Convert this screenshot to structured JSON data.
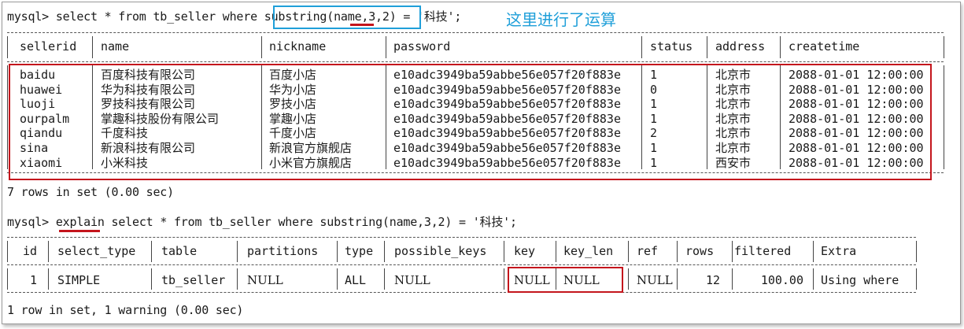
{
  "query1": {
    "prompt": "mysql>",
    "text_before": " select * from tb_seller where ",
    "highlight": "substring(name,3,2)",
    "text_after": " = '科技';",
    "annotation": "这里进行了运算"
  },
  "table1": {
    "columns": [
      "sellerid",
      "name",
      "nickname",
      "password",
      "status",
      "address",
      "createtime"
    ],
    "rows": [
      [
        "baidu",
        "百度科技有限公司",
        "百度小店",
        "e10adc3949ba59abbe56e057f20f883e",
        "1",
        "北京市",
        "2088-01-01 12:00:00"
      ],
      [
        "huawei",
        "华为科技有限公司",
        "华为小店",
        "e10adc3949ba59abbe56e057f20f883e",
        "0",
        "北京市",
        "2088-01-01 12:00:00"
      ],
      [
        "luoji",
        "罗技科技有限公司",
        "罗技小店",
        "e10adc3949ba59abbe56e057f20f883e",
        "1",
        "北京市",
        "2088-01-01 12:00:00"
      ],
      [
        "ourpalm",
        "掌趣科技股份有限公司",
        "掌趣小店",
        "e10adc3949ba59abbe56e057f20f883e",
        "1",
        "北京市",
        "2088-01-01 12:00:00"
      ],
      [
        "qiandu",
        "千度科技",
        "千度小店",
        "e10adc3949ba59abbe56e057f20f883e",
        "2",
        "北京市",
        "2088-01-01 12:00:00"
      ],
      [
        "sina",
        "新浪科技有限公司",
        "新浪官方旗舰店",
        "e10adc3949ba59abbe56e057f20f883e",
        "1",
        "北京市",
        "2088-01-01 12:00:00"
      ],
      [
        "xiaomi",
        "小米科技",
        "小米官方旗舰店",
        "e10adc3949ba59abbe56e057f20f883e",
        "1",
        "西安市",
        "2088-01-01 12:00:00"
      ]
    ],
    "footer": "7 rows in set (0.00 sec)"
  },
  "query2": {
    "prompt": "mysql>",
    "keyword": "explain",
    "text": " select * from tb_seller where substring(name,3,2) = '科技';"
  },
  "table2": {
    "columns": [
      "id",
      "select_type",
      "table",
      "partitions",
      "type",
      "possible_keys",
      "key",
      "key_len",
      "ref",
      "rows",
      "filtered",
      "Extra"
    ],
    "row": [
      "1",
      "SIMPLE",
      "tb_seller",
      "NULL",
      "ALL",
      "NULL",
      "NULL",
      "NULL",
      "NULL",
      "12",
      "100.00",
      "Using where"
    ],
    "footer": "1 row in set, 1 warning (0.00 sec)"
  },
  "colors": {
    "highlight_red": "#c4151c",
    "annotation_blue": "#1f9fd9"
  }
}
